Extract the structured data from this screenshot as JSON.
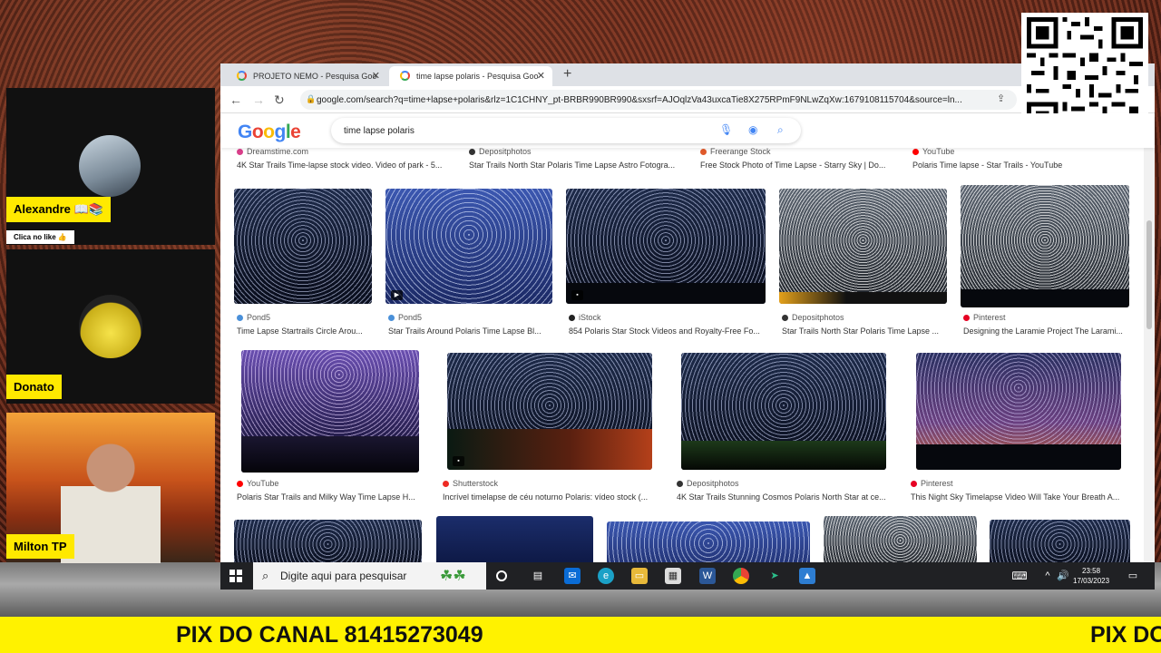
{
  "participants": [
    {
      "name": "Alexandre 📖📚",
      "sub": "Clica no like 👍"
    },
    {
      "name": "Donato"
    },
    {
      "name": "Milton TP"
    }
  ],
  "browser": {
    "tabs": [
      {
        "title": "PROJETO NEMO - Pesquisa Goo"
      },
      {
        "title": "time lapse polaris - Pesquisa Goo"
      }
    ],
    "url": "google.com/search?q=time+lapse+polaris&rlz=1C1CHNY_pt-BRBR990BR990&sxsrf=AJOqlzVa43uxcaTie8X275RPmF9NLwZqXw:1679108115704&source=ln..."
  },
  "google": {
    "logo": "Google",
    "query": "time lapse polaris"
  },
  "top_row": [
    {
      "source": "Dreamstime.com",
      "caption": "4K Star Trails Time-lapse stock video. Video of park - 5...",
      "color": "#d93f8a"
    },
    {
      "source": "Depositphotos",
      "caption": "Star Trails North Star Polaris Time Lapse Astro Fotogra...",
      "color": "#333333"
    },
    {
      "source": "Freerange Stock",
      "caption": "Free Stock Photo of Time Lapse - Starry Sky | Do...",
      "color": "#e05a2b"
    },
    {
      "source": "YouTube",
      "caption": "Polaris Time lapse - Star Trails - YouTube",
      "color": "#ff0000"
    }
  ],
  "row1": [
    {
      "source": "Pond5",
      "caption": "Time Lapse Startrails Circle Arou...",
      "color": "#4a90d9"
    },
    {
      "source": "Pond5",
      "caption": "Star Trails Around Polaris Time Lapse Bl...",
      "color": "#4a90d9"
    },
    {
      "source": "iStock",
      "caption": "854 Polaris Star Stock Videos and Royalty-Free Fo...",
      "color": "#222222"
    },
    {
      "source": "Depositphotos",
      "caption": "Star Trails North Star Polaris Time Lapse ...",
      "color": "#333333"
    },
    {
      "source": "Pinterest",
      "caption": "Designing the Laramie Project The Larami...",
      "color": "#e60023"
    }
  ],
  "row2": [
    {
      "source": "YouTube",
      "caption": "Polaris Star Trails and Milky Way Time Lapse H...",
      "color": "#ff0000"
    },
    {
      "source": "Shutterstock",
      "caption": "Incrível timelapse de céu noturno Polaris: vídeo stock (...",
      "color": "#ee2b24"
    },
    {
      "source": "Depositphotos",
      "caption": "4K Star Trails Stunning Cosmos Polaris North Star at ce...",
      "color": "#333333"
    },
    {
      "source": "Pinterest",
      "caption": "This Night Sky Timelapse Video Will Take Your Breath A...",
      "color": "#e60023"
    }
  ],
  "taskbar": {
    "search_placeholder": "Digite aqui para pesquisar",
    "time": "23:58",
    "date": "17/03/2023"
  },
  "banner": {
    "text": "PIX DO CANAL 81415273049",
    "text_repeat": "PIX DO"
  }
}
